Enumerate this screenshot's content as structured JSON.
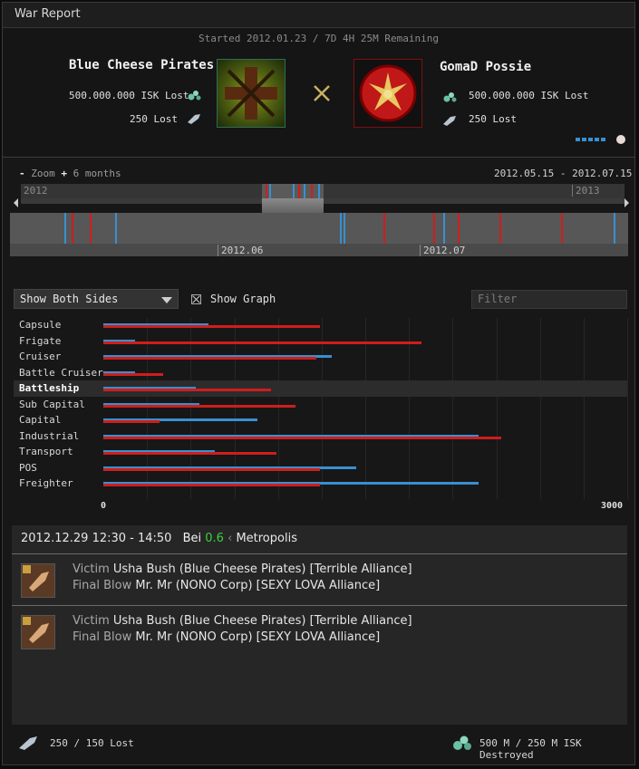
{
  "window": {
    "title": "War Report"
  },
  "war": {
    "started": "Started 2012.01.23 / 7D 4H 25M Remaining",
    "attacker": {
      "name": "Blue Cheese Pirates",
      "isk_lost": "500.000.000 ISK Lost",
      "ships_lost": "250 Lost"
    },
    "defender": {
      "name": "GomaD Possie",
      "isk_lost": "500.000.000 ISK Lost",
      "ships_lost": "250 Lost"
    }
  },
  "timeline": {
    "zoom_out": "-",
    "zoom_label": "Zoom",
    "zoom_in": "+",
    "zoom_level": "6 months",
    "range": "2012.05.15 - 2012.07.15",
    "year_left": "2012",
    "year_right": "2013",
    "month1": "2012.06",
    "month2": "2012.07"
  },
  "controls": {
    "side_filter": "Show Both Sides",
    "show_graph": "Show Graph",
    "filter_placeholder": "Filter"
  },
  "chart_data": {
    "type": "bar",
    "categories": [
      "Capsule",
      "Frigate",
      "Cruiser",
      "Battle Cruiser",
      "Battleship",
      "Sub Capital",
      "Capital",
      "Industrial",
      "Transport",
      "POS",
      "Freighter"
    ],
    "highlighted_category": "Battleship",
    "series": [
      {
        "color": "#3a8fd0",
        "values": [
          600,
          180,
          1310,
          180,
          530,
          550,
          880,
          2150,
          640,
          1450,
          2150
        ]
      },
      {
        "color": "#d01d1d",
        "values": [
          1240,
          1820,
          1220,
          340,
          960,
          1100,
          320,
          2280,
          990,
          1240,
          1240
        ]
      }
    ],
    "xlim": [
      0,
      3000
    ],
    "xticks": [
      "0",
      "3000"
    ],
    "grid": true
  },
  "killfeed": {
    "header": {
      "time": "2012.12.29 12:30 - 14:50",
      "system": "Bei",
      "security": "0.6",
      "region": "Metropolis"
    },
    "events": [
      {
        "victim_label": "Victim",
        "victim": "Usha Bush",
        "victim_corp": "(Blue Cheese Pirates)",
        "victim_alliance": "[Terrible Alliance]",
        "fb_label": "Final Blow",
        "fb": "Mr. Mr",
        "fb_corp": "(NONO Corp)",
        "fb_alliance": "[SEXY LOVA Alliance]"
      },
      {
        "victim_label": "Victim",
        "victim": "Usha Bush",
        "victim_corp": "(Blue Cheese Pirates)",
        "victim_alliance": "[Terrible Alliance]",
        "fb_label": "Final Blow",
        "fb": "Mr. Mr",
        "fb_corp": "(NONO Corp)",
        "fb_alliance": "[SEXY LOVA Alliance]"
      }
    ]
  },
  "footer": {
    "ships_lost": "250 / 150 Lost",
    "isk_destroyed": "500 M / 250 M ISK Destroyed"
  },
  "colors": {
    "blue": "#3a8fd0",
    "red": "#d01d1d",
    "security_green": "#3bd13b"
  }
}
